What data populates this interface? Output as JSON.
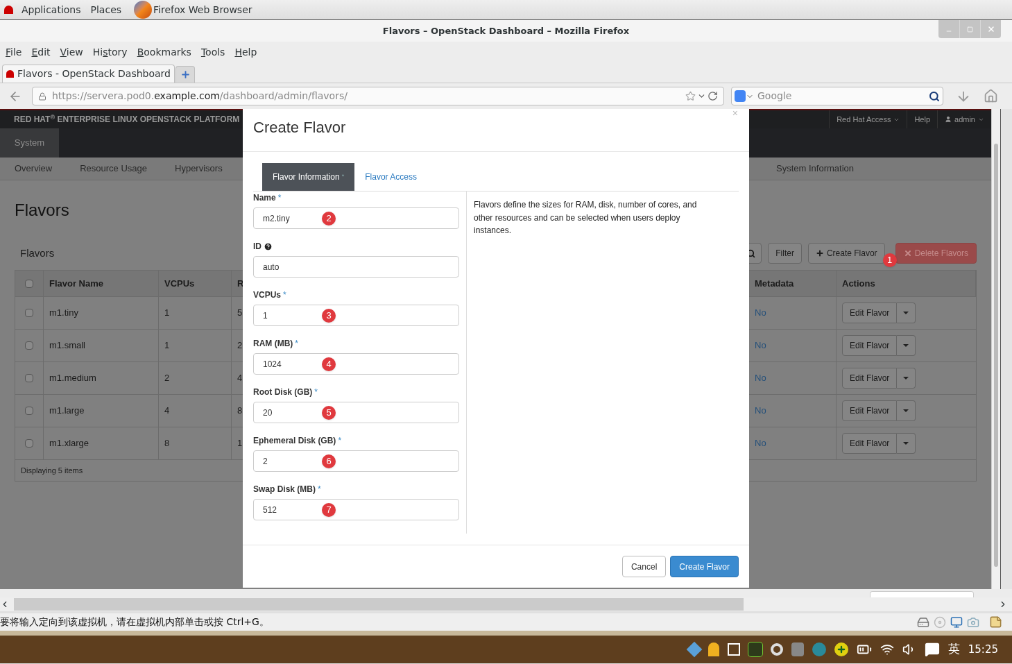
{
  "desktop_bar": {
    "menus": [
      "Applications",
      "Places"
    ],
    "app": "Firefox Web Browser"
  },
  "window": {
    "title": "Flavors – OpenStack Dashboard – Mozilla Firefox"
  },
  "menu": [
    {
      "key": "F",
      "post": "ile"
    },
    {
      "key": "E",
      "post": "dit"
    },
    {
      "key": "V",
      "post": "iew"
    },
    {
      "pre": "Hi",
      "key": "s",
      "post": "tory"
    },
    {
      "key": "B",
      "post": "ookmarks"
    },
    {
      "key": "T",
      "post": "ools"
    },
    {
      "key": "H",
      "post": "elp"
    }
  ],
  "tabs": [
    {
      "title": "Flavors - OpenStack Dashboard",
      "selected": true
    }
  ],
  "url": {
    "prefix": "https://servera.pod0.",
    "domain": "example.com",
    "path": "/dashboard/admin/flavors/"
  },
  "search": {
    "placeholder": "Google"
  },
  "dashboard": {
    "brand": "RED HAT$^{®}$ ENTERPRISE LINUX OPENSTACK PLATFORM",
    "top_links": [
      {
        "label": "Red Hat Access",
        "kind": "dropdown"
      },
      {
        "label": "Help",
        "kind": "link"
      },
      {
        "label": "admin",
        "kind": "user"
      }
    ],
    "panels": [
      {
        "label": "System",
        "selected": true
      }
    ],
    "subnav_left": [
      "Overview",
      "Resource Usage",
      "Hypervisors"
    ],
    "subnav_right": [
      "System Information"
    ],
    "page_title": "Flavors",
    "table_title": "Flavors",
    "toolbar": {
      "filter": "Filter",
      "create": "Create Flavor",
      "create_marker": "1",
      "delete": "Delete Flavors"
    },
    "select_all_checked": false,
    "columns_left": [
      "Flavor Name",
      "VCPUs",
      "R"
    ],
    "columns_right": [
      "Metadata",
      "Actions"
    ],
    "rows": [
      {
        "name": "m1.tiny",
        "vcpus": "1",
        "column_4": "5",
        "metadata": "No",
        "action": "Edit Flavor",
        "checked": false
      },
      {
        "name": "m1.small",
        "vcpus": "1",
        "column_4": "2",
        "metadata": "No",
        "action": "Edit Flavor",
        "checked": false
      },
      {
        "name": "m1.medium",
        "vcpus": "2",
        "column_4": "4",
        "metadata": "No",
        "action": "Edit Flavor",
        "checked": false
      },
      {
        "name": "m1.large",
        "vcpus": "4",
        "column_4": "8",
        "metadata": "No",
        "action": "Edit Flavor",
        "checked": false
      },
      {
        "name": "m1.xlarge",
        "vcpus": "8",
        "column_4": "1",
        "metadata": "No",
        "action": "Edit Flavor",
        "checked": false
      }
    ],
    "footer": "Displaying 5 items"
  },
  "modal": {
    "title": "Create Flavor",
    "close": "×",
    "tabs": [
      {
        "label": "Flavor Information",
        "mark": "*",
        "selected": true
      },
      {
        "label": "Flavor Access",
        "selected": false
      }
    ],
    "fields": [
      {
        "label": "Name",
        "mark": "*",
        "value": "m2.tiny",
        "marker": "2"
      },
      {
        "label": "ID",
        "help": true,
        "value": "auto"
      },
      {
        "label": "VCPUs",
        "mark": "*",
        "value": "1",
        "marker": "3"
      },
      {
        "label": "RAM (MB)",
        "mark": "*",
        "value": "1024",
        "marker": "4"
      },
      {
        "label": "Root Disk (GB)",
        "mark": "*",
        "value": "20",
        "marker": "5"
      },
      {
        "label": "Ephemeral Disk (GB)",
        "mark": "*",
        "value": "2",
        "marker": "6"
      },
      {
        "label": "Swap Disk (MB)",
        "mark": "*",
        "value": "512",
        "marker": "7"
      }
    ],
    "description": "Flavors define the sizes for RAM, disk, number of cores, and other resources and can be selected when users deploy instances.",
    "cancel": "Cancel",
    "submit": "Create Flavor"
  },
  "status_bar": {
    "message": "要将输入定向到该虚拟机，请在虚拟机内部单击或按 Ctrl+G。"
  },
  "taskbar": {
    "ime": "英",
    "clock": "15:25"
  }
}
